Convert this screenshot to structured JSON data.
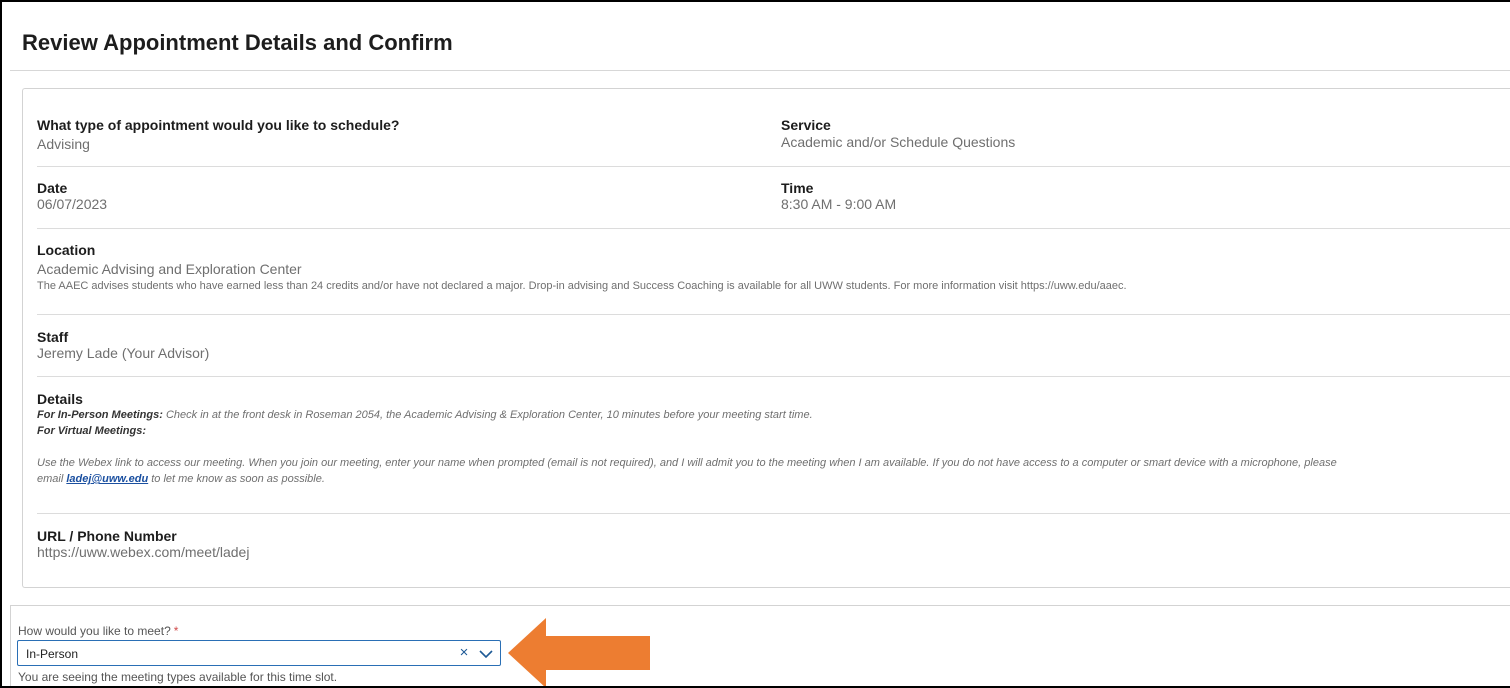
{
  "page": {
    "title": "Review Appointment Details and Confirm"
  },
  "details": {
    "appointment_type": {
      "label": "What type of appointment would you like to schedule?",
      "value": "Advising"
    },
    "service": {
      "label": "Service",
      "value": "Academic and/or Schedule Questions"
    },
    "date": {
      "label": "Date",
      "value": "06/07/2023"
    },
    "time": {
      "label": "Time",
      "value": "8:30 AM - 9:00 AM"
    },
    "location": {
      "label": "Location",
      "value": "Academic Advising and Exploration Center",
      "description": "The AAEC advises students who have earned less than 24 credits and/or have not declared a major. Drop-in advising and Success Coaching is available for all UWW students. For more information visit https://uww.edu/aaec."
    },
    "staff": {
      "label": "Staff",
      "value": "Jeremy Lade (Your Advisor)"
    },
    "details": {
      "label": "Details",
      "in_person_heading": "For In-Person Meetings:",
      "in_person_text": " Check in at the front desk in Roseman 2054, the Academic Advising & Exploration Center, 10 minutes before your meeting start time.",
      "virtual_heading": "For Virtual Meetings:",
      "virtual_text_1": "Use the Webex link to access our meeting. When you join our meeting, enter your name when prompted (email is not required), and I will admit you to the meeting when I am available. If you do not have access to a computer or smart device with a microphone, please",
      "virtual_text_2": "email ",
      "email_link": "ladej@uww.edu",
      "virtual_text_3": " to let me know as soon as possible."
    },
    "url": {
      "label": "URL / Phone Number",
      "value": "https://uww.webex.com/meet/ladej"
    }
  },
  "meeting": {
    "label": "How would you like to meet?",
    "required_mark": "*",
    "selected": "In-Person",
    "clear_glyph": "×",
    "helper": "You are seeing the meeting types available for this time slot."
  },
  "colors": {
    "arrow": "#ed7d31",
    "accent": "#2a6fb5"
  }
}
